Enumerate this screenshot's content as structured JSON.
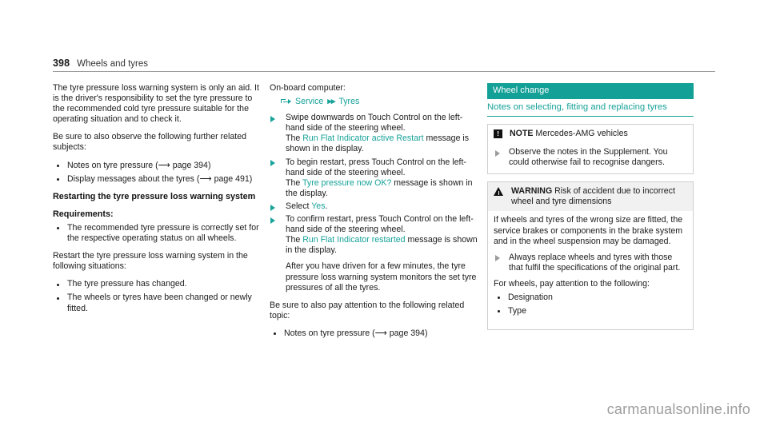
{
  "running_head": {
    "page_number": "398",
    "chapter": "Wheels and tyres"
  },
  "colors": {
    "teal": "#17a299",
    "teal_bar": "#13a096",
    "step_bar": "#d6f2f0",
    "grey_step_bar": "#ebebeb",
    "box_border": "#cfcfcf",
    "warning_header_bg": "#f1f1f1"
  },
  "left_column": {
    "p1": "The tyre pressure loss warning system is only an aid. It is the driver's responsibility to set the tyre pressure to the recommended cold tyre pressure suitable for the operating situation and to check it.",
    "p2": "Be sure to also observe the following further related subjects:",
    "related_subjects": [
      "Notes on tyre pressure (⟶ page 394)",
      "Display messages about the tyres (⟶ page 491)"
    ],
    "subhead": "Restarting the tyre pressure loss warning system",
    "requirements_label": "Requirements:",
    "requirements": [
      "The recommended tyre pressure is correctly set for the respective operating status on all wheels."
    ],
    "p3": "Restart the tyre pressure loss warning system in the following situations:",
    "situations": [
      "The tyre pressure has changed.",
      "The wheels or tyres have been changed or newly fitted."
    ]
  },
  "middle_column": {
    "obc_label": "On-board computer:",
    "nav_path": {
      "corner_icon": "turn-arrow-icon",
      "first": "Service",
      "separator_icon": "double-chevron-icon",
      "second": "Tyres"
    },
    "steps": [
      {
        "text": "Swipe downwards on Touch Control on the left-hand side of the steering wheel.",
        "result_prefix": "The ",
        "result_highlight": "Run Flat Indicator active Restart",
        "result_suffix": " message is shown in the display."
      },
      {
        "text": "To begin restart, press Touch Control on the left-hand side of the steering wheel.",
        "result_prefix": "The ",
        "result_highlight": "Tyre pressure now OK?",
        "result_suffix": " message is shown in the display."
      },
      {
        "text_prefix": "Select ",
        "text_highlight": "Yes",
        "text_suffix": "."
      },
      {
        "text": "To confirm restart, press Touch Control on the left-hand side of the steering wheel.",
        "result_prefix": "The ",
        "result_highlight": "Run Flat Indicator restarted",
        "result_suffix": " message is shown in the display.",
        "note": "After you have driven for a few minutes, the tyre pressure loss warning system monitors the set tyre pressures of all the tyres."
      }
    ],
    "closing_para": "Be sure to also pay attention to the following related topic:",
    "related_topics": [
      "Notes on tyre pressure (⟶ page 394)"
    ]
  },
  "right_column": {
    "panel_title": "Wheel change",
    "panel_subtitle": "Notes on selecting, fitting and replacing tyres",
    "note_box": {
      "icon": "note-icon",
      "label": "NOTE",
      "heading_rest": " Mercedes-AMG vehicles",
      "step": "Observe the notes in the Supplement. You could otherwise fail to recognise dangers."
    },
    "warning_box": {
      "icon": "warning-triangle-icon",
      "label": "WARNING",
      "heading_rest": " Risk of accident due to incorrect wheel and tyre dimensions",
      "body": "If wheels and tyres of the wrong size are fitted, the service brakes or components in the brake system and in the wheel suspension may be damaged.",
      "step": "Always replace wheels and tyres with those that fulfil the specifications of the original part.",
      "after_step": "For wheels, pay attention to the following:",
      "bullets": [
        "Designation",
        "Type"
      ]
    }
  },
  "watermark": "carmanualsonline.info"
}
